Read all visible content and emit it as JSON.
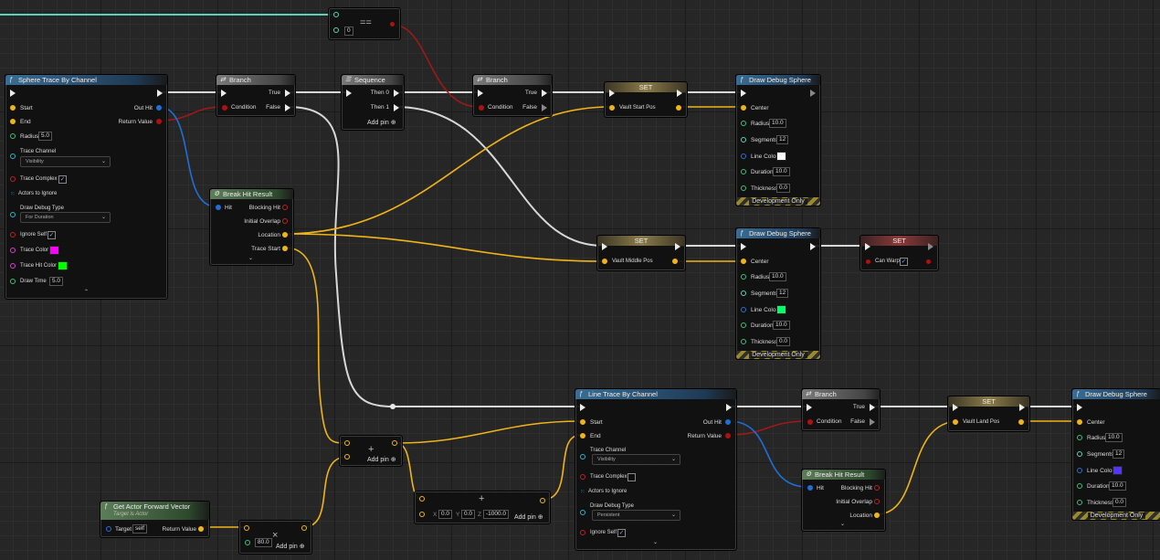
{
  "nodes": {
    "equal": {
      "op": "==",
      "input": "0"
    },
    "sphere_trace": {
      "title": "Sphere Trace By Channel",
      "start": "Start",
      "end": "End",
      "radius_label": "Radius",
      "radius": "5.0",
      "trace_channel_label": "Trace Channel",
      "trace_channel": "Visibility",
      "trace_complex_label": "Trace Complex",
      "actors_to_ignore_label": "Actors to Ignore",
      "draw_debug_type_label": "Draw Debug Type",
      "draw_debug_type": "For Duration",
      "ignore_self_label": "Ignore Self",
      "trace_color_label": "Trace Color",
      "trace_hit_color_label": "Trace Hit Color",
      "draw_time_label": "Draw Time",
      "draw_time": "5.0",
      "out_hit": "Out Hit",
      "return_value": "Return Value",
      "colors": {
        "trace": "#ff00ff",
        "trace_hit": "#00ff00"
      }
    },
    "branch1": {
      "title": "Branch",
      "condition": "Condition",
      "true": "True",
      "false": "False"
    },
    "sequence": {
      "title": "Sequence",
      "then0": "Then 0",
      "then1": "Then 1",
      "add_pin": "Add pin"
    },
    "branch2": {
      "title": "Branch",
      "condition": "Condition",
      "true": "True",
      "false": "False"
    },
    "set_start": {
      "title": "SET",
      "var": "Vault Start Pos"
    },
    "draw1": {
      "title": "Draw Debug Sphere",
      "center": "Center",
      "radius_label": "Radius",
      "radius": "10.0",
      "segments_label": "Segments",
      "segments": "12",
      "line_color_label": "Line Color",
      "duration_label": "Duration",
      "duration": "10.0",
      "thickness_label": "Thickness",
      "thickness": "0.0",
      "dev_only": "Development Only",
      "line_color": "#ffffff"
    },
    "break_hit1": {
      "title": "Break Hit Result",
      "hit": "Hit",
      "blocking_hit": "Blocking Hit",
      "initial_overlap": "Initial Overlap",
      "location": "Location",
      "trace_start": "Trace Start"
    },
    "set_middle": {
      "title": "SET",
      "var": "Vault Middle Pos"
    },
    "draw2": {
      "title": "Draw Debug Sphere",
      "center": "Center",
      "radius_label": "Radius",
      "radius": "10.0",
      "segments_label": "Segments",
      "segments": "12",
      "line_color_label": "Line Color",
      "duration_label": "Duration",
      "duration": "10.0",
      "thickness_label": "Thickness",
      "thickness": "0.0",
      "dev_only": "Development Only",
      "line_color": "#00ff66"
    },
    "set_warp": {
      "title": "SET",
      "var": "Can Warp"
    },
    "forward": {
      "title": "Get Actor Forward Vector",
      "subtitle": "Target is Actor",
      "target_label": "Target",
      "target": "self",
      "return_value": "Return Value"
    },
    "multiply": {
      "value": "80.0",
      "add_pin": "Add pin"
    },
    "add": {
      "symbol": "+",
      "add_pin": "Add pin"
    },
    "vector_add": {
      "x": "0.0",
      "y": "0.0",
      "z": "-1000.0",
      "add_pin": "Add pin",
      "xl": "X",
      "yl": "Y",
      "zl": "Z"
    },
    "line_trace": {
      "title": "Line Trace By Channel",
      "start": "Start",
      "end": "End",
      "trace_channel_label": "Trace Channel",
      "trace_channel": "Visibility",
      "trace_complex_label": "Trace Complex",
      "actors_to_ignore_label": "Actors to Ignore",
      "draw_debug_type_label": "Draw Debug Type",
      "draw_debug_type": "Persistent",
      "ignore_self_label": "Ignore Self",
      "out_hit": "Out Hit",
      "return_value": "Return Value"
    },
    "branch3": {
      "title": "Branch",
      "condition": "Condition",
      "true": "True",
      "false": "False"
    },
    "break_hit2": {
      "title": "Break Hit Result",
      "hit": "Hit",
      "blocking_hit": "Blocking Hit",
      "initial_overlap": "Initial Overlap",
      "location": "Location"
    },
    "set_land": {
      "title": "SET",
      "var": "Vault Land Pos"
    },
    "draw3": {
      "title": "Draw Debug Sphere",
      "center": "Center",
      "radius_label": "Radius",
      "radius": "10.0",
      "segments_label": "Segments",
      "segments": "12",
      "line_color_label": "Line Color",
      "duration_label": "Duration",
      "duration": "10.0",
      "thickness_label": "Thickness",
      "thickness": "0.0",
      "dev_only": "Development Only",
      "line_color": "#5533ff"
    }
  },
  "wire_colors": {
    "exec": "#d8d8d8",
    "vector": "#f0b418",
    "bool": "#a01818",
    "struct": "#1f6fd6",
    "float": "#5fd0b8"
  }
}
